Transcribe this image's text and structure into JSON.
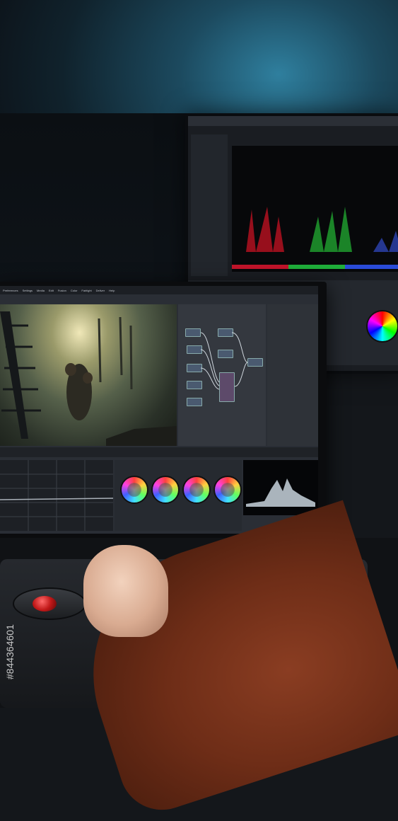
{
  "scene": {
    "description_icon": "photo-scene",
    "colors": {
      "wall_glow": "#2f7f9e",
      "sleeve": "#6e2d17",
      "trackball": "#c01818"
    }
  },
  "front_monitor": {
    "menu": [
      "Preferences",
      "Settings",
      "Media",
      "Edit",
      "Fusion",
      "Color",
      "Fairlight",
      "Deliver",
      "Help"
    ]
  },
  "watermark": {
    "stock_id": "#844364601"
  }
}
